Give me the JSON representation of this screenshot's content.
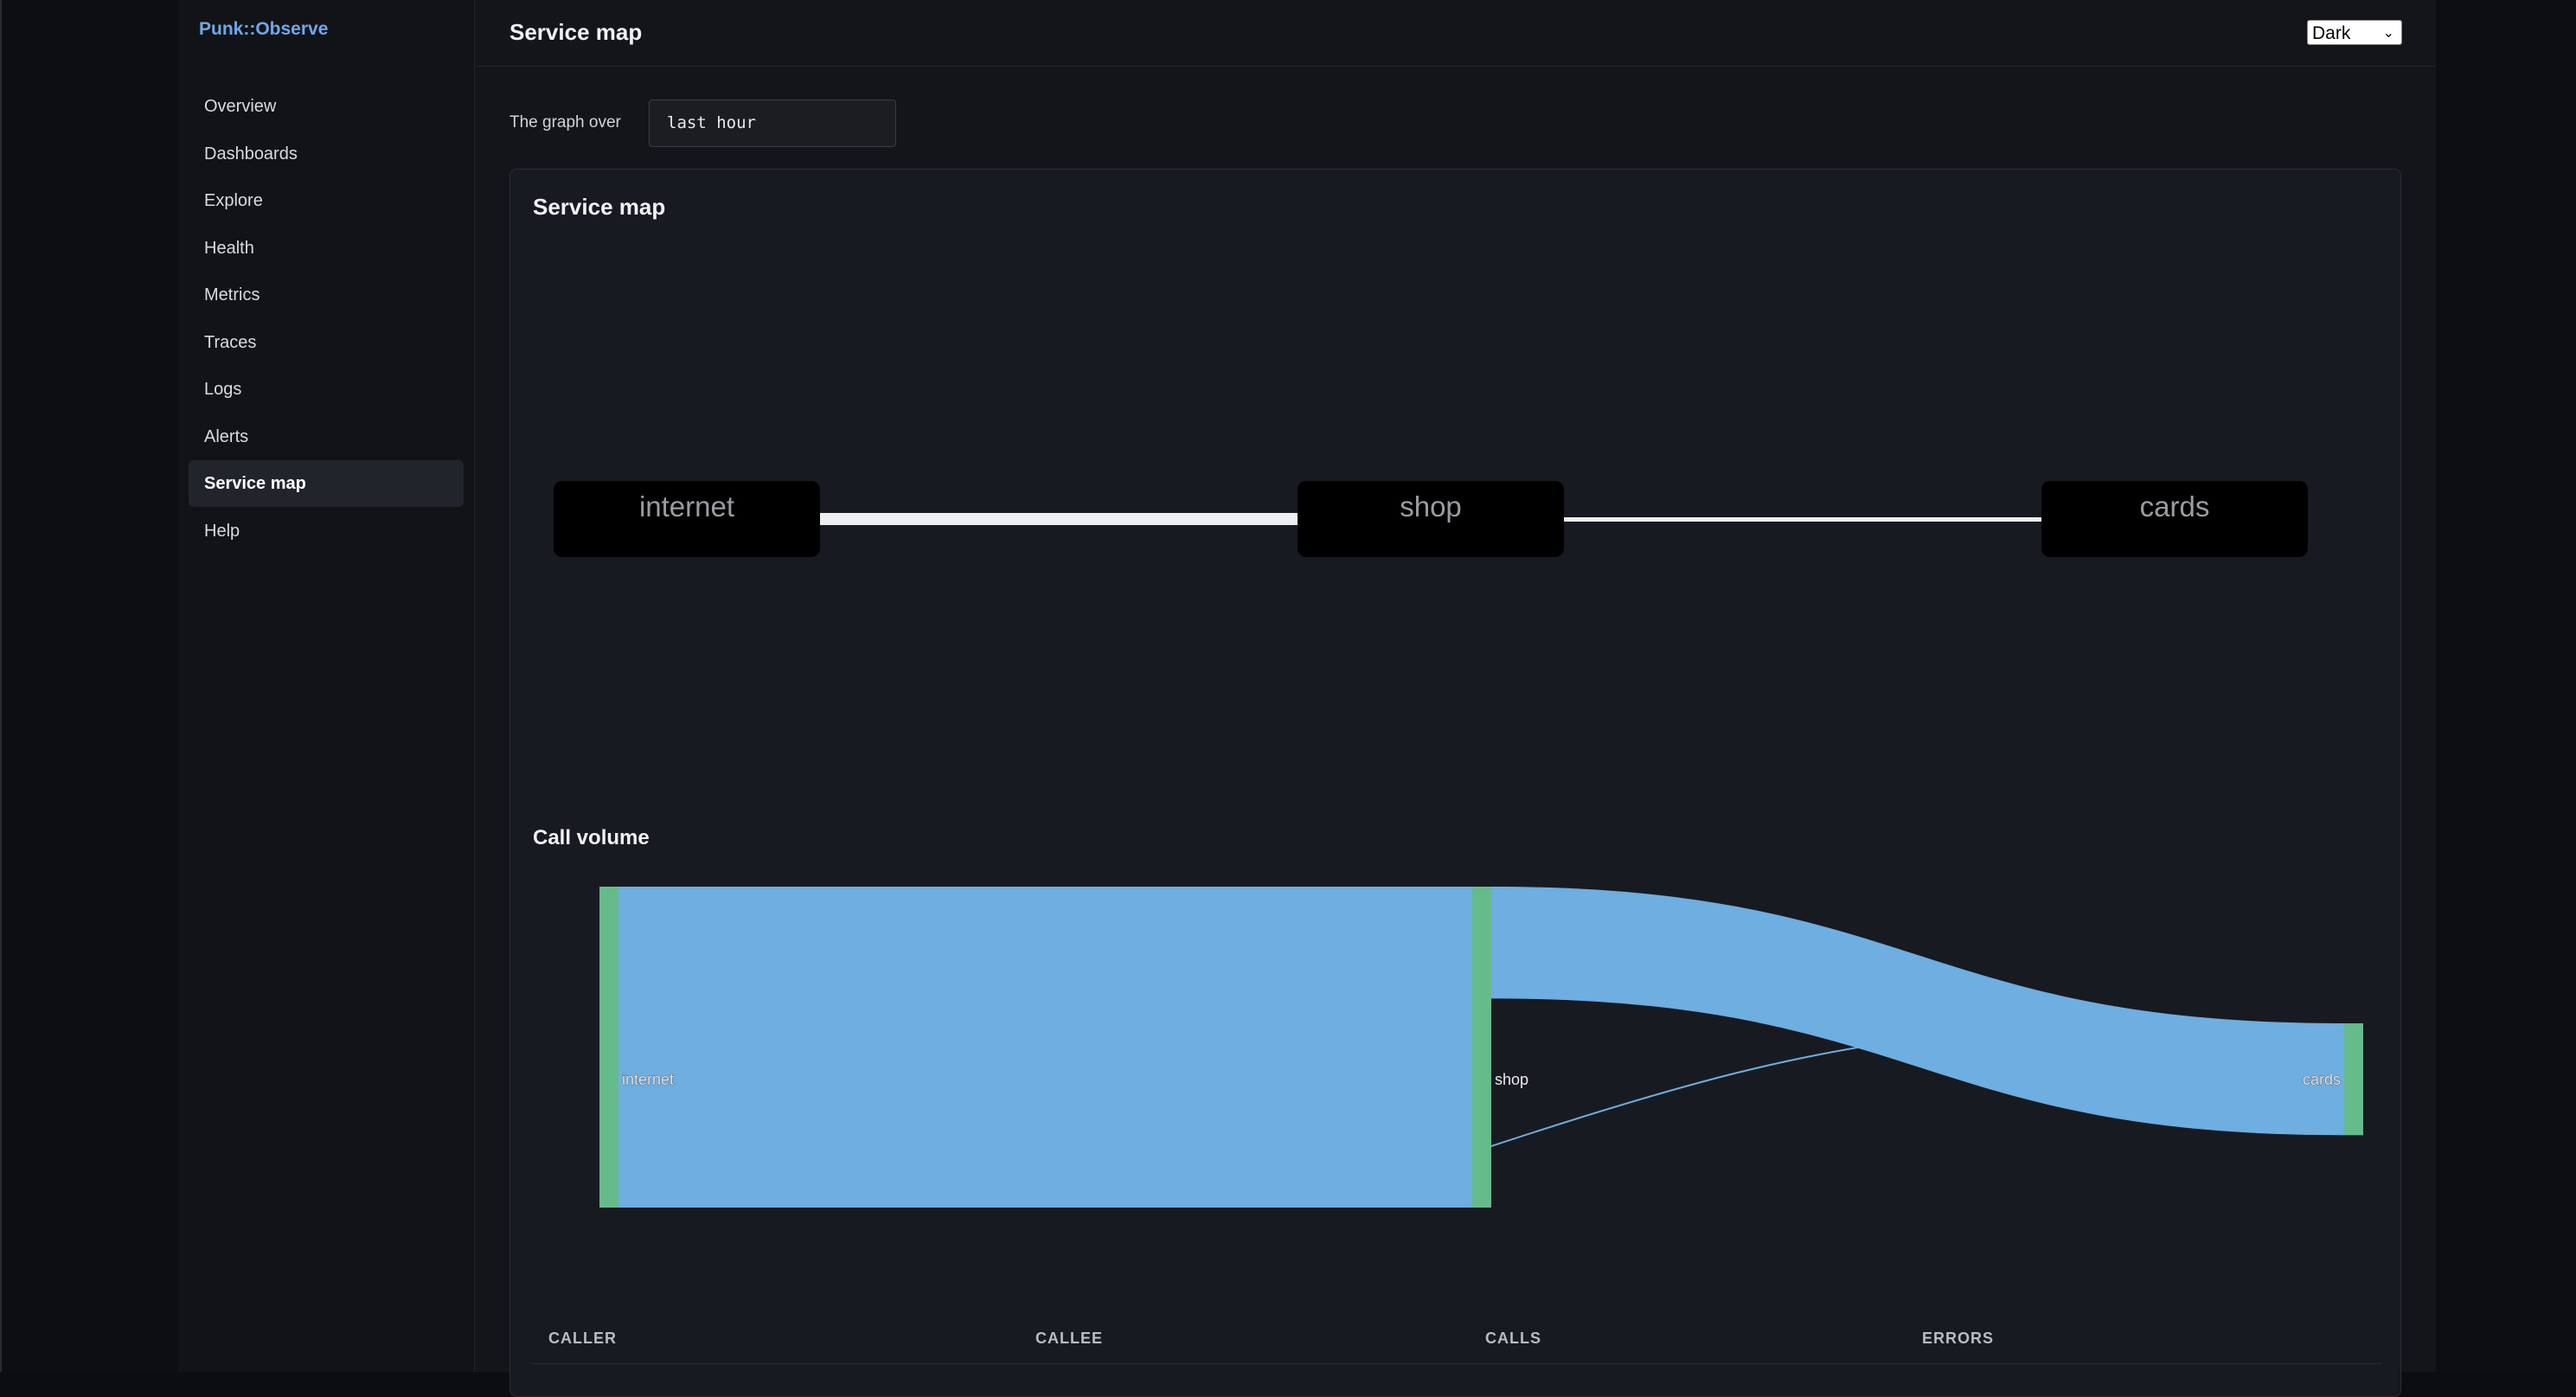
{
  "app": {
    "brand": "Punk::Observe"
  },
  "sidebar": {
    "items": [
      {
        "label": "Overview"
      },
      {
        "label": "Dashboards"
      },
      {
        "label": "Explore"
      },
      {
        "label": "Health"
      },
      {
        "label": "Metrics"
      },
      {
        "label": "Traces"
      },
      {
        "label": "Logs"
      },
      {
        "label": "Alerts"
      },
      {
        "label": "Service map",
        "active": true
      },
      {
        "label": "Help"
      }
    ]
  },
  "header": {
    "title": "Service map",
    "theme": "Dark"
  },
  "range": {
    "label": "The graph over",
    "value": "last hour"
  },
  "panel": {
    "title": "Service map",
    "volume_title": "Call volume"
  },
  "graph": {
    "nodes": [
      "internet",
      "shop",
      "cards"
    ],
    "edges": [
      {
        "from": "internet",
        "to": "shop"
      },
      {
        "from": "shop",
        "to": "cards"
      }
    ]
  },
  "chart_data": {
    "type": "sankey",
    "nodes": [
      "internet",
      "shop",
      "cards"
    ],
    "links": [
      {
        "source": "internet",
        "target": "shop",
        "value": 100
      },
      {
        "source": "shop",
        "target": "cards",
        "value": 29
      },
      {
        "source": "cards",
        "target": "shop",
        "value": 0.5
      }
    ],
    "colors": {
      "link": "#6eaee0",
      "node": "#66bb8a"
    }
  },
  "table": {
    "columns": [
      "CALLER",
      "CALLEE",
      "CALLS",
      "ERRORS"
    ]
  }
}
